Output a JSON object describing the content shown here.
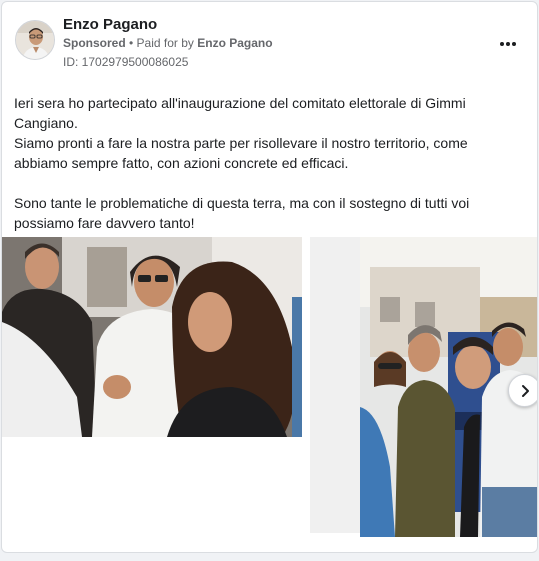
{
  "post": {
    "author": "Enzo Pagano",
    "sponsored_label": "Sponsored",
    "separator": " • ",
    "paid_for_prefix": "Paid for by ",
    "paid_for_name": "Enzo Pagano",
    "ad_id": "ID: 1702979500086025",
    "more_icon": "more-horizontal-icon",
    "text_lines": [
      "Ieri sera ho partecipato all'inaugurazione del comitato elettorale di Gimmi Cangiano.",
      "Siamo pronti a fare la nostra parte per risollevare il nostro territorio, come abbiamo sempre fatto, con azioni concrete ed efficaci.",
      "Sono tante le problematiche di questa terra, ma con il sostegno di tutti voi possiamo fare davvero tanto!"
    ]
  },
  "carousel": {
    "next_icon": "chevron-right-icon"
  },
  "colors": {
    "text_primary": "#1c1e21",
    "text_secondary": "#65676b",
    "card_bg": "#ffffff",
    "page_bg": "#f0f2f5"
  }
}
